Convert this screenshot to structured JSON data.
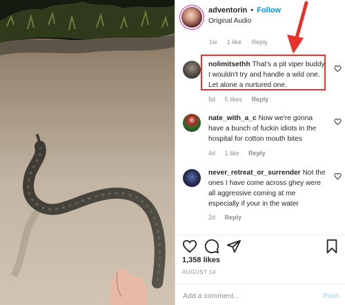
{
  "header": {
    "username": "adventorin",
    "separator": "•",
    "follow_label": "Follow",
    "audio": "Original Audio"
  },
  "previous_comment_meta": {
    "age": "1w",
    "likes": "1 like",
    "reply": "Reply"
  },
  "comments": [
    {
      "username": "nolimitsethh",
      "text": "That's a pit viper buddy. I wouldn't try and handle a wild one. Let alone a nurtured one.",
      "age": "5d",
      "likes": "5 likes",
      "reply": "Reply"
    },
    {
      "username": "nate_with_a_c",
      "text": "Now we're gonna have a bunch of fuckin idiots in the hospital for cotton mouth bites",
      "age": "4d",
      "likes": "1 like",
      "reply": "Reply"
    },
    {
      "username": "never_retreat_or_surrender",
      "text": "Not the ones I have come across ghey were all aggressive coming at me especially if your in the water",
      "age": "2d",
      "likes": "",
      "reply": "Reply"
    }
  ],
  "actions": {
    "likes": "1,358 likes",
    "date": "AUGUST 14"
  },
  "add_comment": {
    "placeholder": "Add a comment...",
    "post_label": "Post"
  },
  "colors": {
    "follow": "#0095f6",
    "highlight": "#e8322d",
    "muted": "#8e8e8e"
  }
}
